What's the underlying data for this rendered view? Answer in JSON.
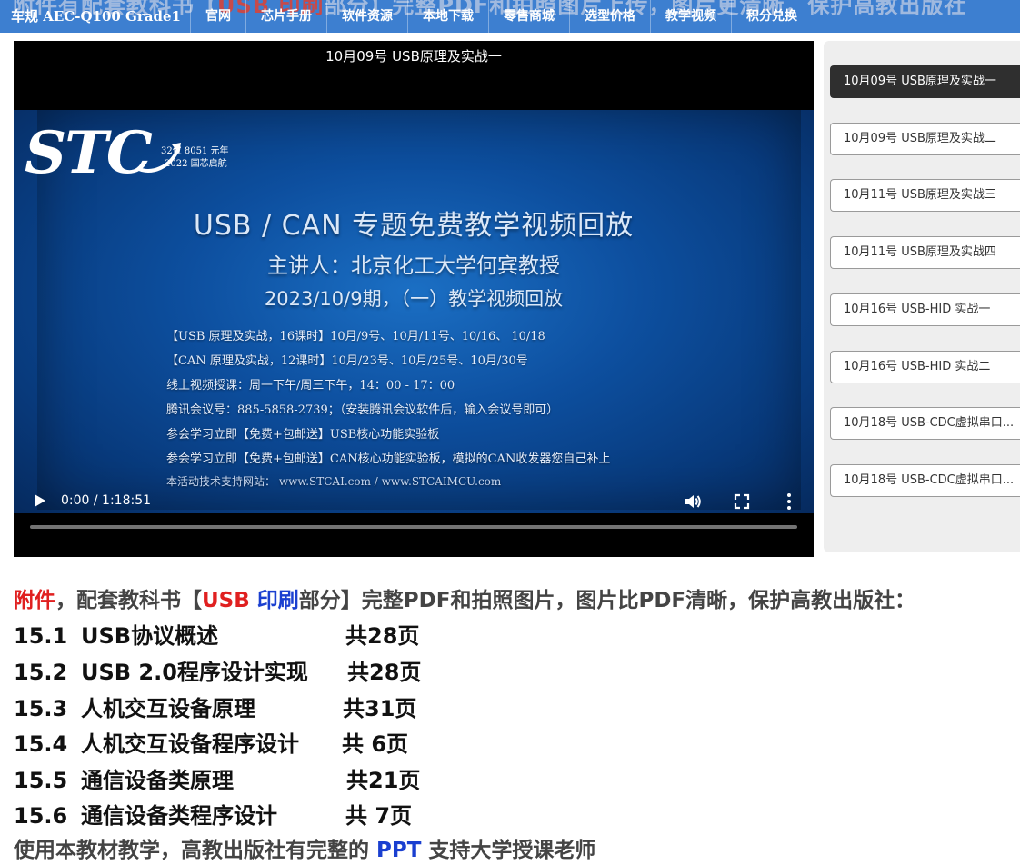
{
  "topbar": {
    "ghost_text_a": "附件有配套教科书【",
    "ghost_text_b": "USB 印刷",
    "ghost_text_c": "部分】完整PDF和拍照图片上传，图片更清晰，保护高教出版社",
    "brand": "车规 AEC-Q100 Grade1",
    "nav": [
      "官网",
      "芯片手册",
      "软件资源",
      "本地下载",
      "零售商城",
      "选型价格",
      "教学视频",
      "积分兑换"
    ]
  },
  "video": {
    "title": "10月09号 USB原理及实战一",
    "logo_text": "STC",
    "logo_tag1": "32位 8051 元年",
    "logo_tag2": "2022 国芯启航",
    "headline1": "USB / CAN 专题免费教学视频回放",
    "headline2": "主讲人：北京化工大学何宾教授",
    "headline3": "2023/10/9期，（一）教学视频回放",
    "lines": [
      "【USB 原理及实战，16课时】10月/9号、10月/11号、10/16、 10/18",
      "【CAN 原理及实战，12课时】10月/23号、10月/25号、10月/30号",
      "线上视频授课：周一下午/周三下午，14：00 - 17：00",
      "腾讯会议号：885-5858-2739；（安装腾讯会议软件后，输入会议号即可）",
      "参会学习立即【免费+包邮送】USB核心功能实验板",
      "参会学习立即【免费+包邮送】CAN核心功能实验板，模拟的CAN收发器您自己补上"
    ],
    "support_line": "本活动技术支持网站：  www.STCAI.com   /   www.STCAIMCU.com",
    "time": "0:00 / 1:18:51",
    "progress": 0.0
  },
  "playlist": {
    "items": [
      "10月09号 USB原理及实战一",
      "10月09号 USB原理及实战二",
      "10月11号 USB原理及实战三",
      "10月11号 USB原理及实战四",
      "10月16号 USB-HID 实战一",
      "10月16号 USB-HID 实战二",
      "10月18号 USB-CDC虚拟串口...",
      "10月18号 USB-CDC虚拟串口..."
    ],
    "active_index": 0
  },
  "content": {
    "intro_red": "附件",
    "intro_a": "，配套教科书【",
    "intro_usb": "USB",
    "intro_print": "印刷",
    "intro_b": "部分】完整PDF和拍照图片，图片比PDF清晰，保护高教出版社：",
    "chapters": [
      {
        "num": "15.1",
        "title": "USB协议概述",
        "pages": "共28页"
      },
      {
        "num": "15.2",
        "title": "USB 2.0程序设计实现",
        "pages": "共28页"
      },
      {
        "num": "15.3",
        "title": "人机交互设备原理",
        "pages": "共31页"
      },
      {
        "num": "15.4",
        "title": "人机交互设备程序设计",
        "pages": "共  6页"
      },
      {
        "num": "15.5",
        "title": "通信设备类原理",
        "pages": "共21页"
      },
      {
        "num": "15.6",
        "title": "通信设备类程序设计",
        "pages": "共  7页"
      }
    ],
    "footer_a": "使用本教材教学，高教出版社有完整的 ",
    "footer_ppt": "PPT",
    "footer_b": " 支持大学授课老师"
  },
  "colors": {
    "topbar": "#3d7fd0",
    "red": "#e02020",
    "blue": "#1a3fd0",
    "active_item": "#2f2f2f"
  }
}
